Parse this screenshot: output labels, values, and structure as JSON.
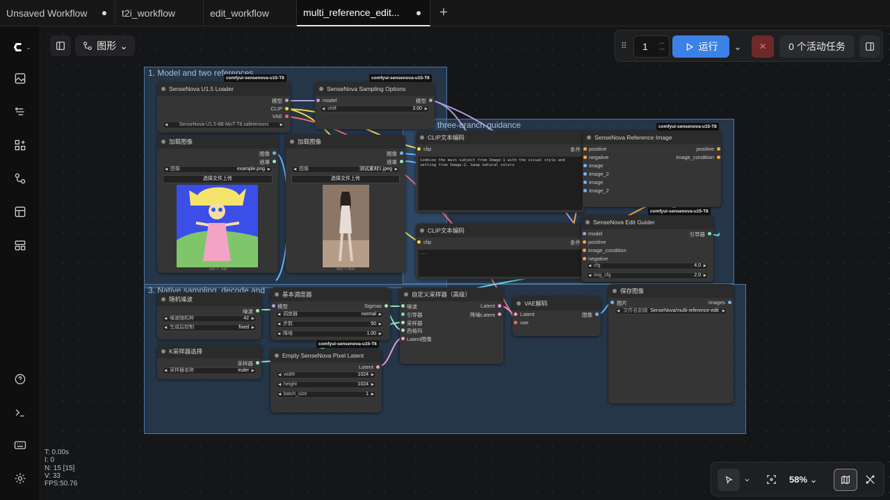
{
  "tabs": [
    {
      "label": "Unsaved Workflow",
      "modified": true
    },
    {
      "label": "t2i_workflow",
      "modified": false
    },
    {
      "label": "edit_workflow",
      "modified": false
    },
    {
      "label": "multi_reference_edit...",
      "modified": true
    }
  ],
  "sidebar_icons": [
    "comfy-logo-icon",
    "image-icon",
    "model-icon",
    "nodes-icon",
    "workflow-icon",
    "template-icon",
    "queue-icon",
    "help-icon",
    "terminal-icon",
    "keyboard-icon",
    "settings-icon"
  ],
  "view": {
    "mode_label": "图形"
  },
  "run": {
    "batch_count": "1",
    "run_label": "运行",
    "active_tasks": "0 个活动任务"
  },
  "colors": {
    "run_blue": "#3c82e6",
    "stop_red": "#6e2a2a",
    "group_blue": "#3a5e84"
  },
  "groups": [
    {
      "title": "1. Model and two references"
    },
    {
      "title": "three-branch guidance"
    },
    {
      "title": "3. Native sampling, decode and"
    }
  ],
  "badge": "comfyui-sensenova-u15-T8",
  "nodes": {
    "loader": {
      "title": "SenseNova U1.5 Loader",
      "out": [
        "模型",
        "CLIP",
        "VAE"
      ],
      "ckpt": "SenseNova-U1.5-8B-MoT-T8.safetensors"
    },
    "sampling_opts": {
      "title": "SenseNova Sampling Options",
      "in": "model",
      "out": "模型",
      "shift_label": "shift",
      "shift": "3.00"
    },
    "load1": {
      "title": "加载图像",
      "out": [
        "图像",
        "遮罩"
      ],
      "img_label": "图像",
      "img": "example.png",
      "upload": "选择文件上传",
      "size": "768 × 768"
    },
    "load2": {
      "title": "加载图像",
      "out": [
        "图像",
        "遮罩"
      ],
      "img_label": "图像",
      "img": "测试素材1.jpeg",
      "upload": "选择文件上传",
      "size": "450 × 800"
    },
    "clip1": {
      "title": "CLIP文本编码",
      "in": "clip",
      "out": "条件",
      "text": "Combine the main subject from Image-1 with the visual style and setting from Image-2, keep natural colors"
    },
    "clip2": {
      "title": "CLIP文本编码",
      "in": "clip",
      "out": "条件",
      "text": "..."
    },
    "refimg": {
      "title": "SenseNova Reference Image",
      "in": [
        "positive",
        "negative",
        "image",
        "image_2",
        "image",
        "image_2"
      ],
      "out": [
        "positive",
        "image_condition"
      ]
    },
    "guider": {
      "title": "SenseNova Edit Guider",
      "in": [
        "model",
        "positive",
        "image_condition",
        "negative"
      ],
      "out": "引导器",
      "cfg_label": "cfg",
      "cfg": "4.0",
      "imgcfg_label": "img_cfg",
      "imgcfg": "2.0"
    },
    "noise": {
      "title": "随机噪波",
      "out": "噪波",
      "seed_label": "噪波随机种",
      "seed": "42",
      "ctrl_label": "生成后控制",
      "ctrl": "fixed"
    },
    "ksel": {
      "title": "K采样器选择",
      "out": "采样器",
      "name_label": "采样器名称",
      "name": "euler"
    },
    "sched": {
      "title": "基本调度器",
      "in": "模型",
      "out": "Sigmas",
      "sch_label": "调度器",
      "sch": "normal",
      "steps_label": "步数",
      "steps": "50",
      "den_label": "降噪",
      "den": "1.00"
    },
    "latent": {
      "title": "Empty SenseNova Pixel Latent",
      "out": "Latent",
      "w_label": "width",
      "w": "1024",
      "h_label": "height",
      "h": "1024",
      "b_label": "batch_size",
      "b": "1"
    },
    "custom": {
      "title": "自定义采样器（高级）",
      "in": [
        "噪波",
        "引导器",
        "采样器",
        "西格玛",
        "Latent图像"
      ],
      "out": [
        "Latent",
        "降噪Latent"
      ]
    },
    "vae": {
      "title": "VAE解码",
      "in": [
        "Latent",
        "vae"
      ],
      "out": "图像"
    },
    "save": {
      "title": "保存图像",
      "in": "图片",
      "out": "images",
      "prefix_label": "文件名前缀",
      "prefix": "SenseNova/multi-reference-edit"
    }
  },
  "stats": {
    "t": "T: 0.00s",
    "i": "I: 0",
    "n": "N: 15 [15]",
    "v": "V: 33",
    "fps": "FPS:50.76"
  },
  "zoom": {
    "level": "58%"
  }
}
